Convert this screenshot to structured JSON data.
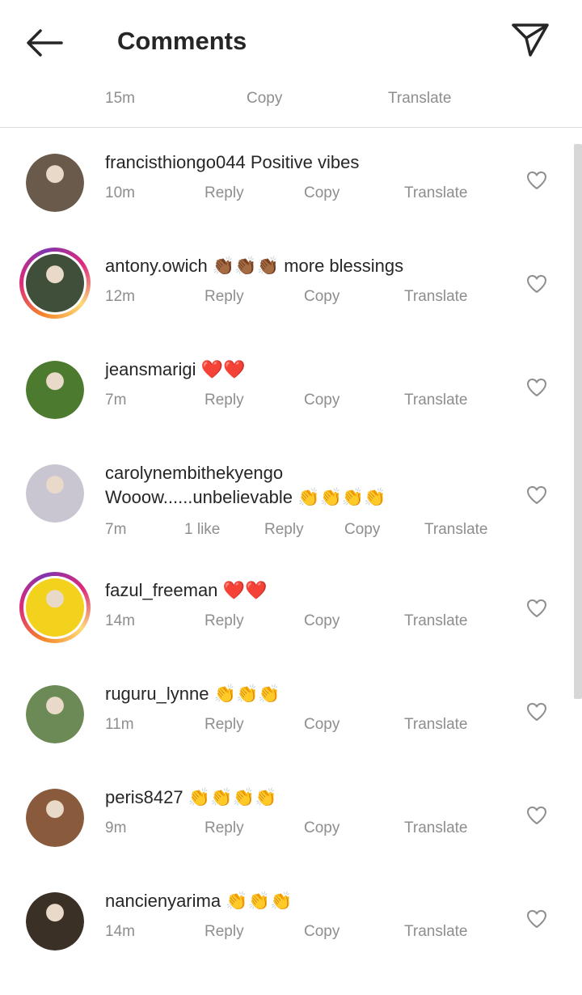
{
  "header": {
    "title": "Comments",
    "back_icon": "arrow-left-icon",
    "send_icon": "paper-plane-icon"
  },
  "top_comment_actions": {
    "time": "15m",
    "copy": "Copy",
    "translate": "Translate"
  },
  "comments": [
    {
      "username": "francisthiongo044",
      "text": "Positive vibes",
      "time": "10m",
      "likes": "",
      "reply": "Reply",
      "copy": "Copy",
      "translate": "Translate",
      "avatar_ring": false,
      "avatar_color": "#6a5a4c"
    },
    {
      "username": "antony.owich",
      "text": "👏🏾👏🏾👏🏾 more blessings",
      "time": "12m",
      "likes": "",
      "reply": "Reply",
      "copy": "Copy",
      "translate": "Translate",
      "avatar_ring": true,
      "avatar_color": "#3f4f3a"
    },
    {
      "username": "jeansmarigi",
      "text": "❤️❤️",
      "time": "7m",
      "likes": "",
      "reply": "Reply",
      "copy": "Copy",
      "translate": "Translate",
      "avatar_ring": false,
      "avatar_color": "#4c7a2f"
    },
    {
      "username": "carolynembithekyengo",
      "text": "Wooow......unbelievable 👏👏👏👏",
      "time": "7m",
      "likes": "1 like",
      "reply": "Reply",
      "copy": "Copy",
      "translate": "Translate",
      "avatar_ring": false,
      "avatar_color": "#c9c6d2"
    },
    {
      "username": "fazul_freeman",
      "text": "❤️❤️",
      "time": "14m",
      "likes": "",
      "reply": "Reply",
      "copy": "Copy",
      "translate": "Translate",
      "avatar_ring": true,
      "avatar_color": "#f2d21c"
    },
    {
      "username": "ruguru_lynne",
      "text": "👏👏👏",
      "time": "11m",
      "likes": "",
      "reply": "Reply",
      "copy": "Copy",
      "translate": "Translate",
      "avatar_ring": false,
      "avatar_color": "#6b8a55"
    },
    {
      "username": "peris8427",
      "text": "👏👏👏👏",
      "time": "9m",
      "likes": "",
      "reply": "Reply",
      "copy": "Copy",
      "translate": "Translate",
      "avatar_ring": false,
      "avatar_color": "#8a5a3c"
    },
    {
      "username": "nancienyarima",
      "text": "👏👏👏",
      "time": "14m",
      "likes": "",
      "reply": "Reply",
      "copy": "Copy",
      "translate": "Translate",
      "avatar_ring": false,
      "avatar_color": "#3b3026"
    }
  ],
  "colors": {
    "text": "#262626",
    "secondary": "#8e8e8e",
    "divider": "#dbdbdb"
  }
}
